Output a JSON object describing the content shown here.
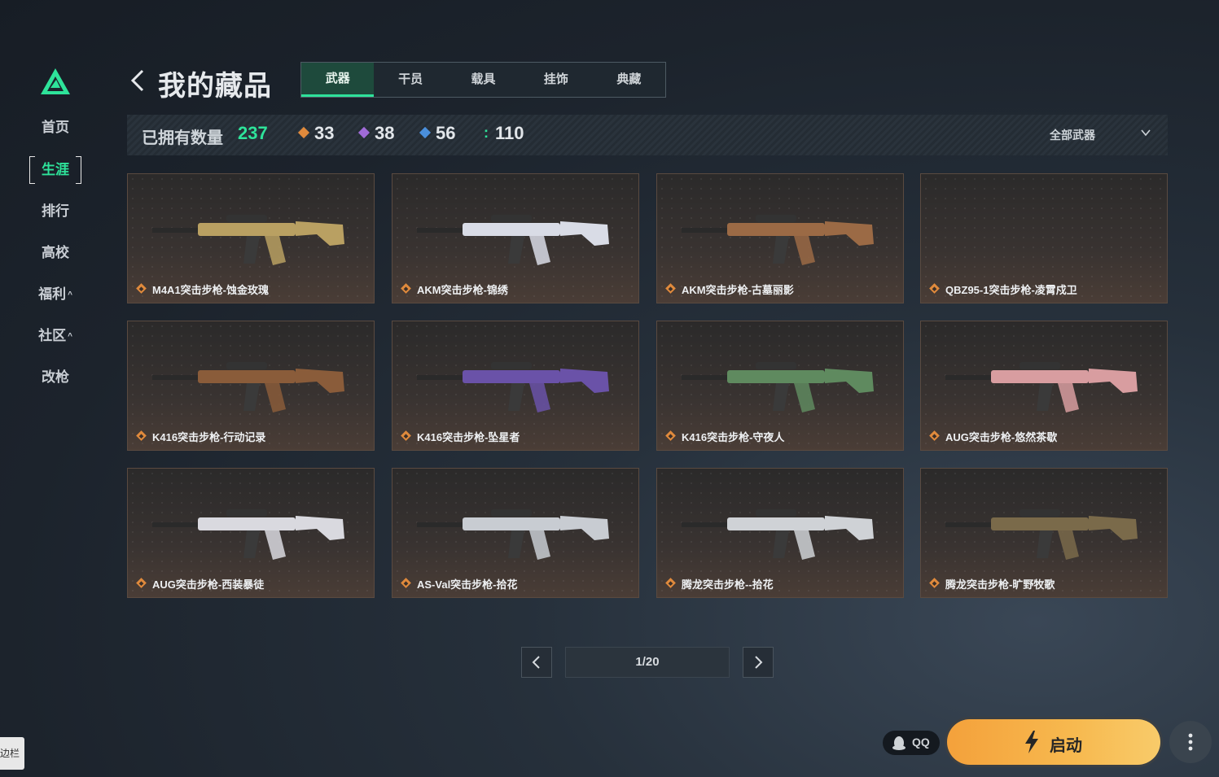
{
  "sidebar": {
    "items": [
      {
        "label": "首页"
      },
      {
        "label": "生涯"
      },
      {
        "label": "排行"
      },
      {
        "label": "高校"
      },
      {
        "label": "福利"
      },
      {
        "label": "社区"
      },
      {
        "label": "改枪"
      }
    ],
    "active_index": 1,
    "tag": "边栏"
  },
  "header": {
    "title": "我的藏品",
    "tabs": [
      {
        "label": "武器"
      },
      {
        "label": "干员"
      },
      {
        "label": "载具"
      },
      {
        "label": "挂饰"
      },
      {
        "label": "典藏"
      }
    ],
    "active_tab": 0
  },
  "stats": {
    "owned_label": "已拥有数量",
    "owned_count": "237",
    "counts": [
      {
        "value": "33",
        "color": "#e08a3c"
      },
      {
        "value": "38",
        "color": "#a06bd8"
      },
      {
        "value": "56",
        "color": "#4a8fdc"
      },
      {
        "value": "110",
        "color": "#2ee39a"
      }
    ],
    "filter_label": "全部武器"
  },
  "items": [
    {
      "name": "M4A1突击步枪-蚀金玫瑰",
      "gun_color": "#b9a062"
    },
    {
      "name": "AKM突击步枪-锦绣",
      "gun_color": "#d9dce6"
    },
    {
      "name": "AKM突击步枪-古墓丽影",
      "gun_color": "#9b6a45"
    },
    {
      "name": "QBZ95-1突击步枪-凌霄戍卫",
      "gun_color": ""
    },
    {
      "name": "K416突击步枪-行动记录",
      "gun_color": "#8a5c3a"
    },
    {
      "name": "K416突击步枪-坠星者",
      "gun_color": "#6a52a8"
    },
    {
      "name": "K416突击步枪-守夜人",
      "gun_color": "#5f8a5f"
    },
    {
      "name": "AUG突击步枪-悠然茶歇",
      "gun_color": "#d89da0"
    },
    {
      "name": "AUG突击步枪-西装暴徒",
      "gun_color": "#d9d9df"
    },
    {
      "name": "AS-Val突击步枪-拾花",
      "gun_color": "#c8ccd2"
    },
    {
      "name": "腾龙突击步枪--拾花",
      "gun_color": "#cfd2d6"
    },
    {
      "name": "腾龙突击步枪-旷野牧歌",
      "gun_color": "#7a6a4a"
    }
  ],
  "pagination": {
    "indicator": "1/20"
  },
  "bottom": {
    "account": "QQ",
    "launch_label": "启动"
  }
}
